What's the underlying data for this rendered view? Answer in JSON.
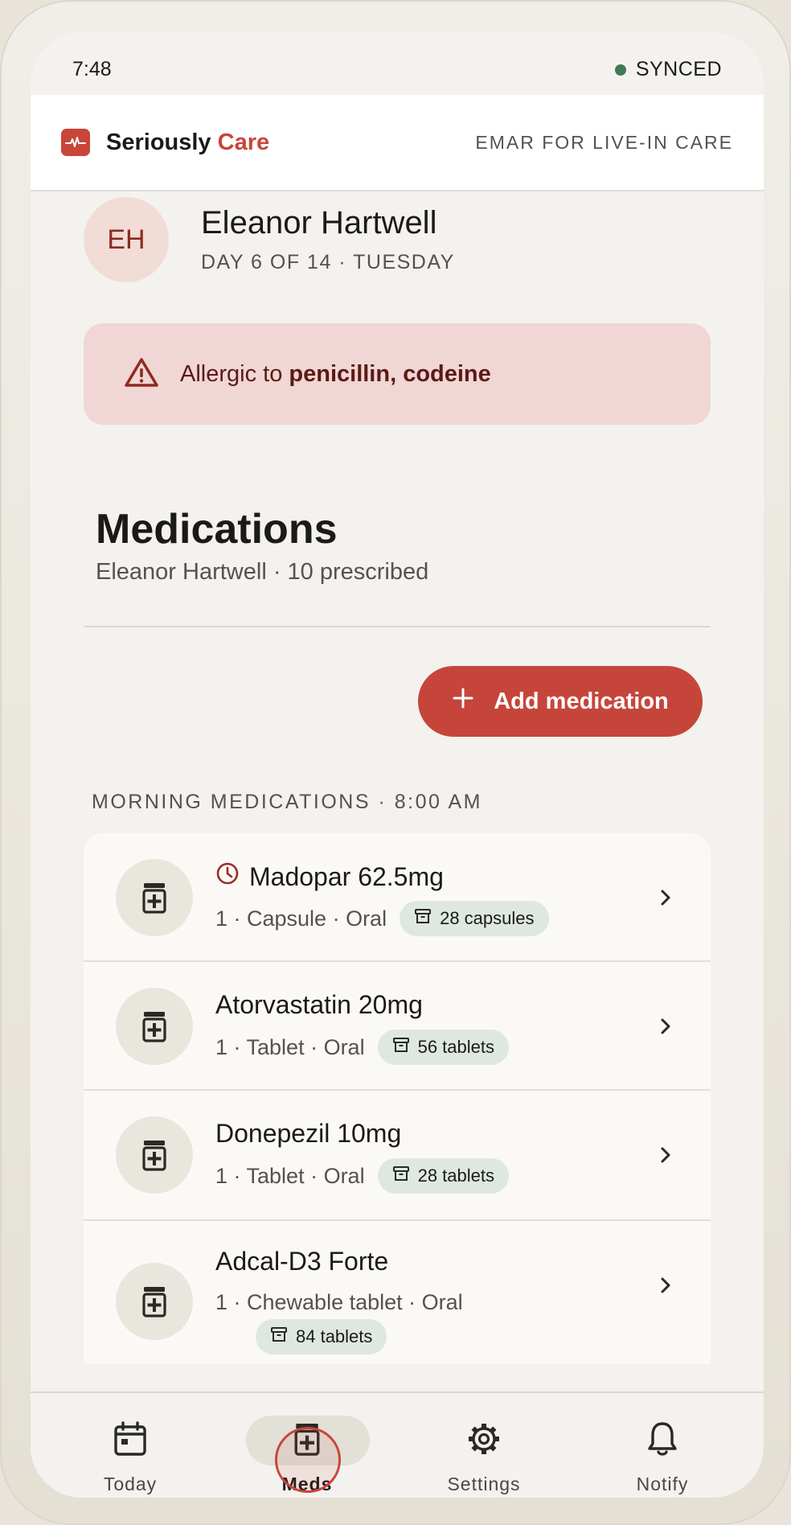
{
  "status_bar": {
    "time": "7:48",
    "sync": "SYNCED"
  },
  "header": {
    "brand_first": "Seriously",
    "brand_accent": "Care",
    "subtitle": "EMAR FOR LIVE-IN CARE"
  },
  "patient": {
    "initials": "EH",
    "name": "Eleanor Hartwell",
    "day": "DAY 6 OF 14 · TUESDAY"
  },
  "allergy": {
    "prefix": "Allergic to ",
    "items": "penicillin, codeine"
  },
  "medications": {
    "title": "Medications",
    "subtitle": "Eleanor Hartwell · 10 prescribed",
    "add_label": "Add medication",
    "section_label": "MORNING MEDICATIONS · 8:00 AM",
    "items": [
      {
        "name": "Madopar 62.5mg",
        "detail": "1 · Capsule · Oral",
        "stock": "28 capsules",
        "time_sensitive": true
      },
      {
        "name": "Atorvastatin 20mg",
        "detail": "1 · Tablet · Oral",
        "stock": "56 tablets",
        "time_sensitive": false
      },
      {
        "name": "Donepezil 10mg",
        "detail": "1 · Tablet · Oral",
        "stock": "28 tablets",
        "time_sensitive": false
      },
      {
        "name": "Adcal-D3 Forte",
        "detail": "1 · Chewable tablet · Oral",
        "stock": "84 tablets",
        "time_sensitive": false
      }
    ]
  },
  "nav": {
    "items": [
      {
        "label": "Today",
        "icon": "calendar-icon"
      },
      {
        "label": "Meds",
        "icon": "medicine-bottle-icon",
        "active": true
      },
      {
        "label": "Settings",
        "icon": "gear-icon"
      },
      {
        "label": "Notify",
        "icon": "bell-icon"
      }
    ]
  },
  "colors": {
    "accent": "#c8453a",
    "sync": "#3f7a55",
    "allergy_bg": "#f0d6d4",
    "stock_bg": "#dfe8e0"
  }
}
